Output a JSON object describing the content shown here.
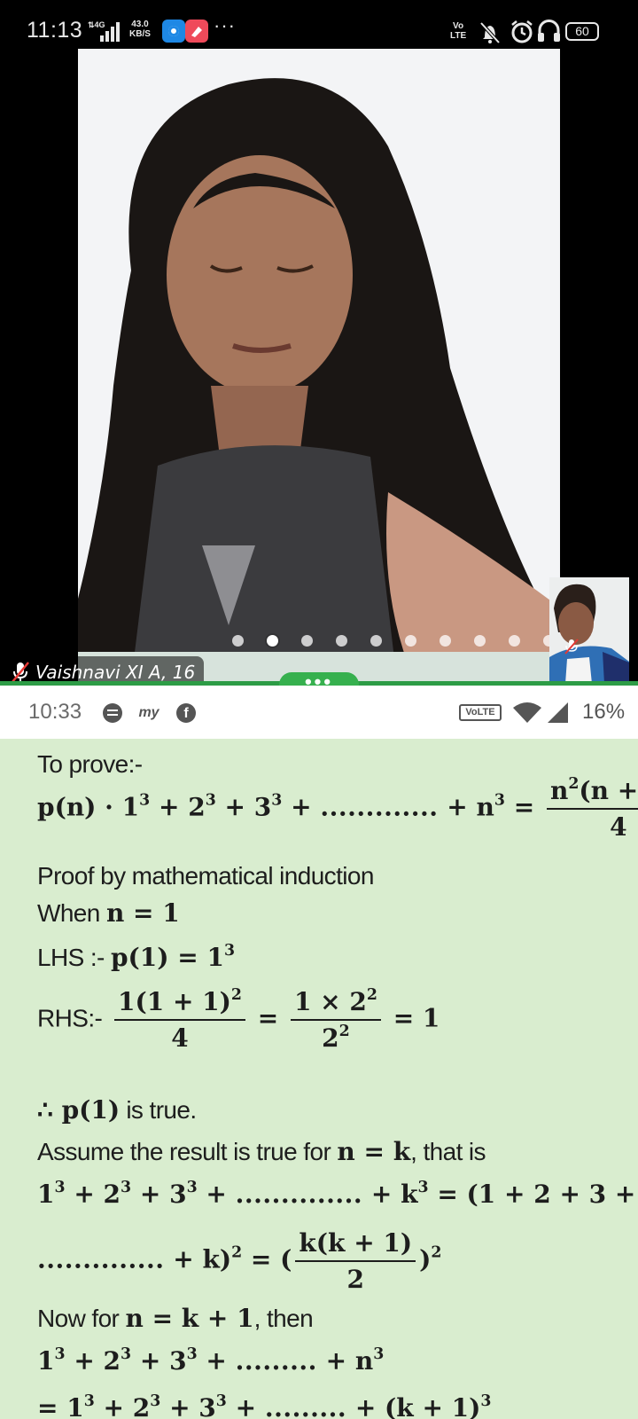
{
  "status_bar": {
    "time": "11:13",
    "network": "4G",
    "speed_value": "43.0",
    "speed_unit": "KB/S",
    "more": "···",
    "volte": "Vo\nLTE",
    "battery": "60"
  },
  "video_call": {
    "participant_name": "Vaishnavi XI A, 16",
    "page_dots_count": 10,
    "active_page_index": 1,
    "more_button": "•••",
    "accent_color": "#2d9c46"
  },
  "shared_screen": {
    "status_time": "10:33",
    "status_volte": "VoLTE",
    "status_battery": "16%",
    "background_color": "#d9edcf"
  },
  "lines": {
    "to_prove": "To prove:-",
    "proof_by": "Proof by mathematical induction",
    "when_prefix": "When",
    "lhs_label": "LHS :-",
    "rhs_label": "RHS:-",
    "is_true": "is true.",
    "assume_prefix": "Assume the result is true for",
    "assume_suffix": ", that is",
    "now_prefix": "Now for",
    "now_suffix": ", then"
  }
}
